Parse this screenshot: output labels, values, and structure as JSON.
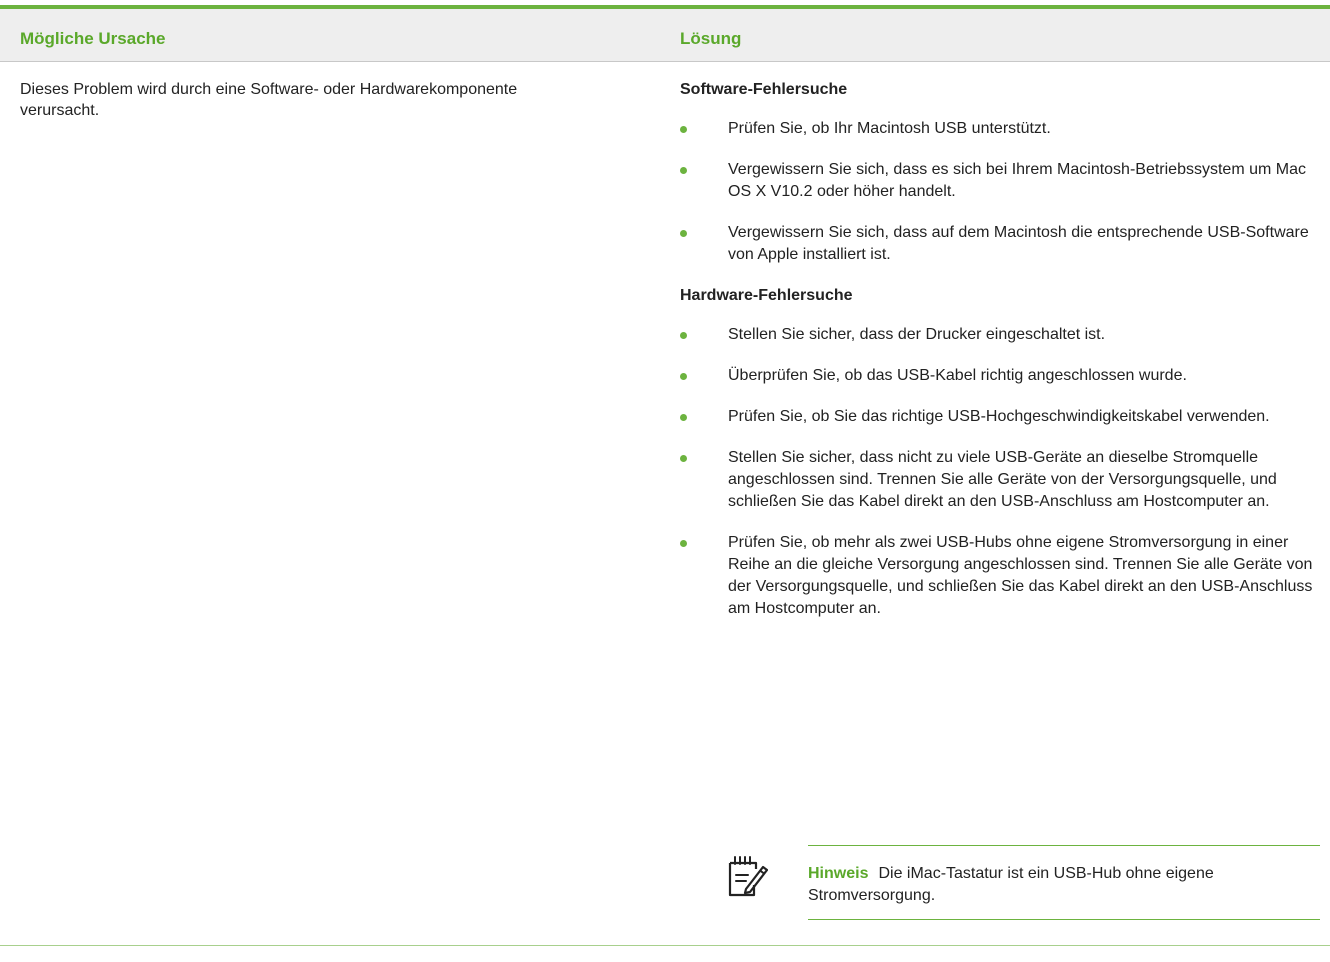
{
  "table": {
    "header": {
      "cause": "Mögliche Ursache",
      "solution": "Lösung"
    },
    "cause_text": "Dieses Problem wird durch eine Software- oder Hardwarekomponente verursacht.",
    "software": {
      "title": "Software-Fehlersuche",
      "items": [
        "Prüfen Sie, ob Ihr Macintosh USB unterstützt.",
        "Vergewissern Sie sich, dass es sich bei Ihrem Macintosh-Betriebssystem um Mac OS X V10.2 oder höher handelt.",
        "Vergewissern Sie sich, dass auf dem Macintosh die entsprechende USB-Software von Apple installiert ist."
      ]
    },
    "hardware": {
      "title": "Hardware-Fehlersuche",
      "items": [
        "Stellen Sie sicher, dass der Drucker eingeschaltet ist.",
        "Überprüfen Sie, ob das USB-Kabel richtig angeschlossen wurde.",
        "Prüfen Sie, ob Sie das richtige USB-Hochgeschwindigkeitskabel verwenden.",
        "Stellen Sie sicher, dass nicht zu viele USB-Geräte an dieselbe Stromquelle angeschlossen sind. Trennen Sie alle Geräte von der Versorgungsquelle, und schließen Sie das Kabel direkt an den USB-Anschluss am Hostcomputer an.",
        "Prüfen Sie, ob mehr als zwei USB-Hubs ohne eigene Stromversorgung in einer Reihe an die gleiche Versorgung angeschlossen sind. Trennen Sie alle Geräte von der Versorgungsquelle, und schließen Sie das Kabel direkt an den USB-Anschluss am Hostcomputer an."
      ]
    },
    "note": {
      "icon": "note-pencil-icon",
      "label": "Hinweis",
      "text": "Die iMac-Tastatur ist ein USB-Hub ohne eigene Stromversorgung."
    }
  },
  "colors": {
    "accent": "#6cb33f",
    "header_text": "#5aa82a",
    "header_bg": "#eeeeee"
  }
}
